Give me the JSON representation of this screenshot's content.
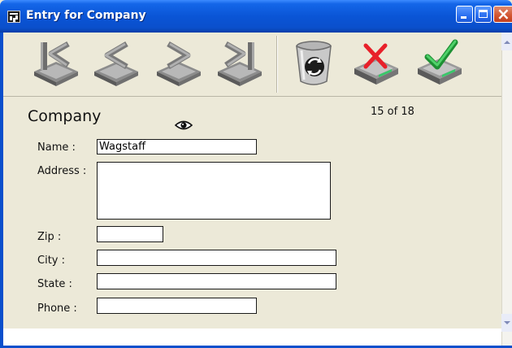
{
  "window": {
    "title": "Entry for Company",
    "controls": [
      "minimize-icon",
      "maximize-icon",
      "close-icon"
    ]
  },
  "toolbar": {
    "buttons": [
      {
        "name": "first-record",
        "icon": "first-record-icon"
      },
      {
        "name": "previous-record",
        "icon": "previous-record-icon"
      },
      {
        "name": "next-record",
        "icon": "next-record-icon"
      },
      {
        "name": "last-record",
        "icon": "last-record-icon"
      },
      {
        "name": "delete-record",
        "icon": "recycle-bin-icon"
      },
      {
        "name": "cancel",
        "icon": "cancel-red-x-icon"
      },
      {
        "name": "save",
        "icon": "save-green-check-icon"
      }
    ]
  },
  "form": {
    "title": "Company",
    "record_position": "15 of 18",
    "fields": {
      "name": {
        "label": "Name :",
        "value": "Wagstaff"
      },
      "address": {
        "label": "Address :",
        "value": ""
      },
      "zip": {
        "label": "Zip :",
        "value": ""
      },
      "city": {
        "label": "City :",
        "value": ""
      },
      "state": {
        "label": "State :",
        "value": ""
      },
      "phone": {
        "label": "Phone :",
        "value": ""
      }
    }
  },
  "colors": {
    "titlebar": "#0a55d6",
    "window_bg": "#ece9d8",
    "cancel_x": "#e8202a",
    "save_check": "#22a83a"
  }
}
